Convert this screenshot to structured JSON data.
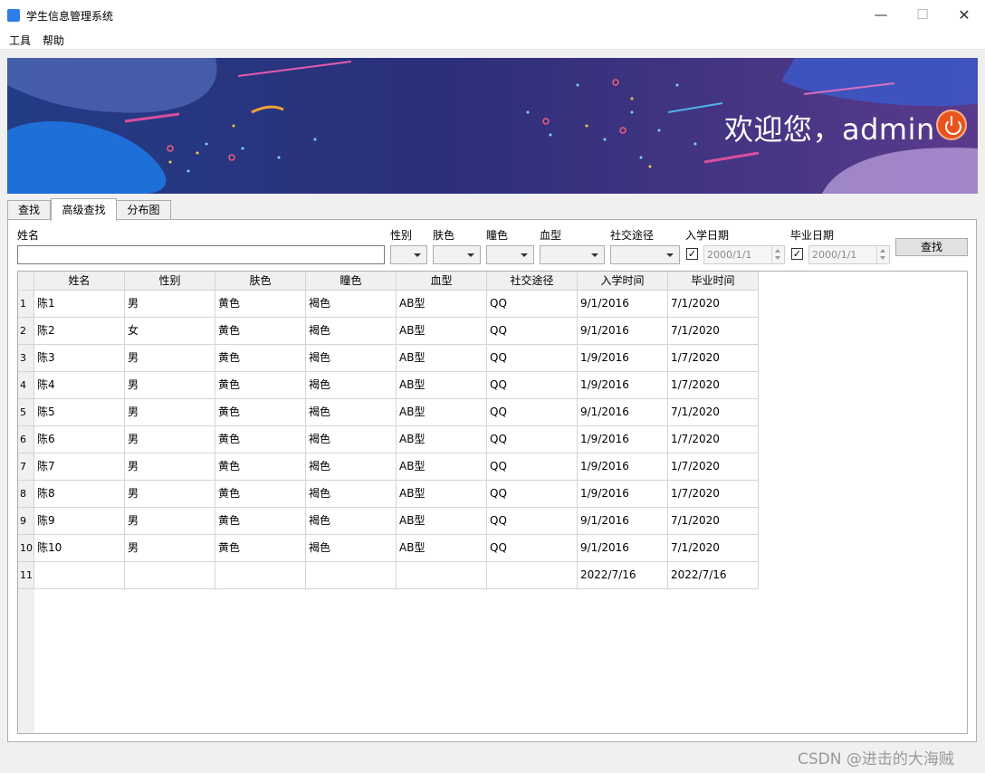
{
  "window": {
    "title": "学生信息管理系统",
    "minimize_icon": "—",
    "maximize_icon": "☐",
    "close_icon": "✕"
  },
  "menu": [
    {
      "label": "工具"
    },
    {
      "label": "帮助"
    }
  ],
  "banner": {
    "welcome": "欢迎您，admin",
    "power_icon": "power-icon"
  },
  "tabs": [
    {
      "label": "查找",
      "active": false
    },
    {
      "label": "高级查找",
      "active": true
    },
    {
      "label": "分布图",
      "active": false
    }
  ],
  "filters": {
    "name_label": "姓名",
    "name_value": "",
    "gender_label": "性别",
    "skin_label": "肤色",
    "pupil_label": "瞳色",
    "blood_label": "血型",
    "social_label": "社交途径",
    "enroll_label": "入学日期",
    "enroll_checked": true,
    "enroll_value": "2000/1/1",
    "grad_label": "毕业日期",
    "grad_checked": true,
    "grad_value": "2000/1/1",
    "search_button": "查找"
  },
  "table": {
    "columns": [
      "姓名",
      "性别",
      "肤色",
      "瞳色",
      "血型",
      "社交途径",
      "入学时间",
      "毕业时间"
    ],
    "rows": [
      {
        "num": "1",
        "cells": [
          "陈1",
          "男",
          "黄色",
          "褐色",
          "AB型",
          "QQ",
          "9/1/2016",
          "7/1/2020"
        ]
      },
      {
        "num": "2",
        "cells": [
          "陈2",
          "女",
          "黄色",
          "褐色",
          "AB型",
          "QQ",
          "9/1/2016",
          "7/1/2020"
        ]
      },
      {
        "num": "3",
        "cells": [
          "陈3",
          "男",
          "黄色",
          "褐色",
          "AB型",
          "QQ",
          "1/9/2016",
          "1/7/2020"
        ]
      },
      {
        "num": "4",
        "cells": [
          "陈4",
          "男",
          "黄色",
          "褐色",
          "AB型",
          "QQ",
          "1/9/2016",
          "1/7/2020"
        ]
      },
      {
        "num": "5",
        "cells": [
          "陈5",
          "男",
          "黄色",
          "褐色",
          "AB型",
          "QQ",
          "9/1/2016",
          "7/1/2020"
        ]
      },
      {
        "num": "6",
        "cells": [
          "陈6",
          "男",
          "黄色",
          "褐色",
          "AB型",
          "QQ",
          "1/9/2016",
          "1/7/2020"
        ]
      },
      {
        "num": "7",
        "cells": [
          "陈7",
          "男",
          "黄色",
          "褐色",
          "AB型",
          "QQ",
          "1/9/2016",
          "1/7/2020"
        ]
      },
      {
        "num": "8",
        "cells": [
          "陈8",
          "男",
          "黄色",
          "褐色",
          "AB型",
          "QQ",
          "1/9/2016",
          "1/7/2020"
        ]
      },
      {
        "num": "9",
        "cells": [
          "陈9",
          "男",
          "黄色",
          "褐色",
          "AB型",
          "QQ",
          "9/1/2016",
          "7/1/2020"
        ]
      },
      {
        "num": "10",
        "cells": [
          "陈10",
          "男",
          "黄色",
          "褐色",
          "AB型",
          "QQ",
          "9/1/2016",
          "7/1/2020"
        ]
      },
      {
        "num": "11",
        "cells": [
          "",
          "",
          "",
          "",
          "",
          "",
          "2022/7/16",
          "2022/7/16"
        ]
      }
    ]
  },
  "watermark": "CSDN @进击的大海贼"
}
